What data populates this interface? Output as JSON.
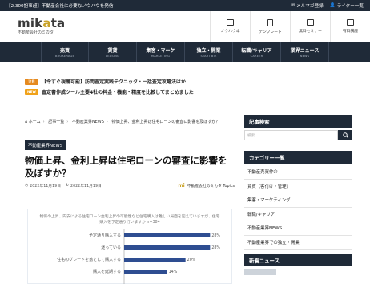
{
  "topbar": {
    "promo": "【2,300記事超】不動産会社に必要なノウハウを発信",
    "mailmag": "メルマガ登録",
    "writer": "ライター一覧"
  },
  "logo": {
    "mark": "mikata",
    "tagline": "不動産会社のミカタ"
  },
  "header_nav": [
    {
      "label": "ノウハウ本",
      "icon": "book-icon"
    },
    {
      "label": "テンプレート",
      "icon": "document-icon"
    },
    {
      "label": "無料セミナー",
      "icon": "monitor-icon"
    },
    {
      "label": "有料講座",
      "icon": "video-icon"
    }
  ],
  "main_nav": [
    {
      "jp": "売買",
      "en": "BROKERAGE"
    },
    {
      "jp": "賃貸",
      "en": "LEASING"
    },
    {
      "jp": "集客・マーケ",
      "en": "MARKETING"
    },
    {
      "jp": "独立・開業",
      "en": "START BIZ"
    },
    {
      "jp": "転職/キャリア",
      "en": "CAREER"
    },
    {
      "jp": "業界ニュース",
      "en": "NEWS"
    }
  ],
  "news": [
    {
      "badge": "注目",
      "text": "【今すぐ視聴可能】訪問査定実践テクニック・一括査定攻略法はか"
    },
    {
      "badge": "NEW",
      "text": "査定書作成ツール主要4社の料金・機能・精度を比較してまとめました"
    }
  ],
  "breadcrumb": [
    "ホーム",
    "記事一覧",
    "不動産業界NEWS",
    "物価上昇、金利上昇は住宅ローンの審査に影響を及ぼすか？"
  ],
  "article": {
    "category": "不動産業界NEWS",
    "title": "物価上昇、金利上昇は住宅ローンの審査に影響を及ぼすか？",
    "published": "2022年11月19日",
    "updated": "2022年11月19日",
    "author_logo": "mi",
    "author": "不動産会社のミカタ Topics"
  },
  "chart_data": {
    "type": "bar",
    "title": "物価の上昇、円安による住宅ローン金利上昇の可能性など住宅購入は難しい局面を迎えていますが、住宅購入を予定通り行いますか n=384",
    "categories": [
      "予定通り購入する",
      "迷っている",
      "住宅のグレードを落として購入する",
      "購入を延期する"
    ],
    "values": [
      28,
      28,
      20,
      14
    ],
    "value_labels": [
      "28%",
      "28%",
      "20%",
      "14%"
    ],
    "xlim": [
      0,
      30
    ],
    "bar_color": "#2e4d91"
  },
  "sidebar": {
    "search_title": "記事検索",
    "search_placeholder": "検索",
    "category_title": "カテゴリー一覧",
    "categories": [
      "不動産売買仲介",
      "賃貸（客付け・管理）",
      "集客・マーケティング",
      "転職/キャリア",
      "不動産業界NEWS",
      "不動産業界での独立・開業"
    ],
    "news_title": "新着ニュース"
  }
}
